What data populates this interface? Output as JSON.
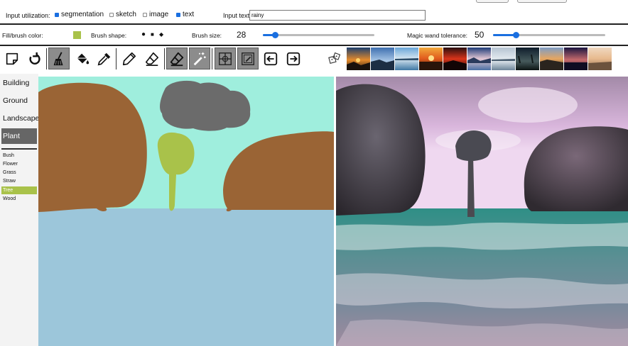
{
  "row1": {
    "label": "Input utilization:",
    "options": [
      {
        "label": "segmentation",
        "checked": true
      },
      {
        "label": "sketch",
        "checked": false
      },
      {
        "label": "image",
        "checked": false
      },
      {
        "label": "text",
        "checked": true
      }
    ],
    "input_text_label": "Input text:",
    "input_text_value": "rainy"
  },
  "row2": {
    "fill_label": "Fill/brush color:",
    "fill_color": "#a9c24a",
    "brush_shape_label": "Brush shape:",
    "brush_size_label": "Brush size:",
    "brush_size_value": "28",
    "brush_size_fraction": 0.11,
    "wand_label": "Magic wand tolerance:",
    "wand_value": "50",
    "wand_fraction": 0.2
  },
  "toolbar": {
    "tools": [
      "new-page-icon",
      "undo-icon",
      "brush-icon",
      "paint-bucket-icon",
      "eyedropper-icon",
      "pencil-icon",
      "sketch-eraser-icon",
      "eraser-icon",
      "magic-wand-icon",
      "segment-grid-icon",
      "sketch-grid-icon",
      "export-left-icon",
      "import-right-icon",
      "random-dice-icon"
    ],
    "active": [
      "brush-icon",
      "eraser-icon",
      "magic-wand-icon",
      "segment-grid-icon",
      "sketch-grid-icon"
    ]
  },
  "categories": [
    "Building",
    "Ground",
    "Landscape",
    "Plant"
  ],
  "selected_category": "Plant",
  "subcategories": [
    "Bush",
    "Flower",
    "Grass",
    "Straw",
    "Tree",
    "Wood"
  ],
  "selected_subcategory": "Tree",
  "colors": {
    "sky": "#9feedd",
    "water": "#9cc6da",
    "rock": "#9a6435",
    "cloud": "#6b6b6b",
    "tree": "#a9c24a",
    "accent": "#1a6fe0",
    "panel_selected": "#666666"
  }
}
